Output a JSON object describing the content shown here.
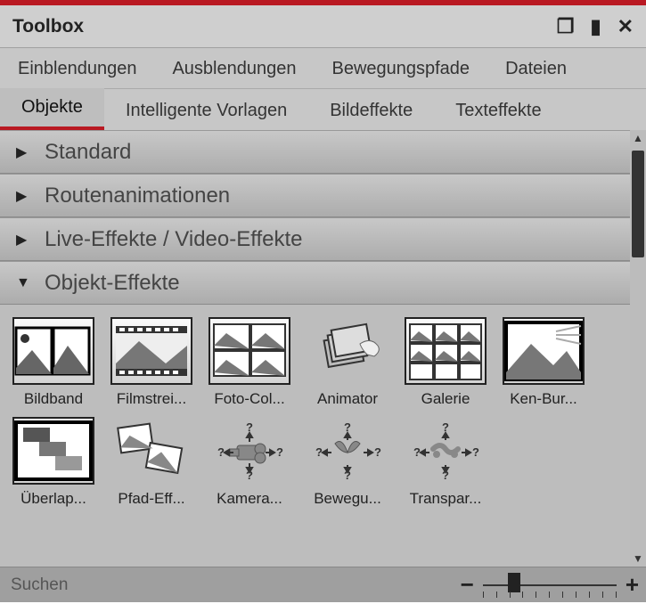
{
  "title": "Toolbox",
  "tabs_top": [
    "Einblendungen",
    "Ausblendungen",
    "Bewegungspfade",
    "Dateien"
  ],
  "tabs_bottom": [
    "Objekte",
    "Intelligente Vorlagen",
    "Bildeffekte",
    "Texteffekte"
  ],
  "active_tab_index": 0,
  "categories": [
    {
      "label": "Standard",
      "expanded": false
    },
    {
      "label": "Routenanimationen",
      "expanded": false
    },
    {
      "label": "Live-Effekte / Video-Effekte",
      "expanded": false
    },
    {
      "label": "Objekt-Effekte",
      "expanded": true
    }
  ],
  "items": [
    {
      "label": "Bildband"
    },
    {
      "label": "Filmstrei..."
    },
    {
      "label": "Foto-Col..."
    },
    {
      "label": "Animator"
    },
    {
      "label": "Galerie"
    },
    {
      "label": "Ken-Bur..."
    },
    {
      "label": "Überlap..."
    },
    {
      "label": "Pfad-Eff..."
    },
    {
      "label": "Kamera..."
    },
    {
      "label": "Bewegu..."
    },
    {
      "label": "Transpar..."
    }
  ],
  "search_placeholder": "Suchen",
  "icons": {
    "minus": "−",
    "plus": "+",
    "maximize": "❐",
    "pin": "⇩",
    "close": "✕"
  }
}
